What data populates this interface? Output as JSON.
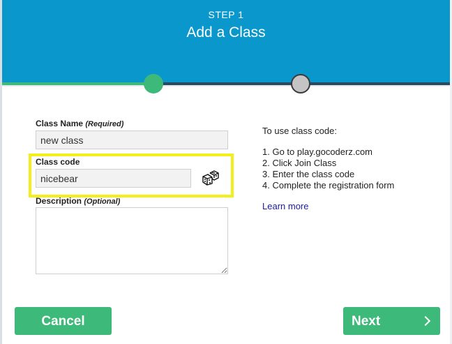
{
  "header": {
    "step": "STEP 1",
    "title": "Add a Class"
  },
  "stepper": {
    "steps": [
      {
        "status": "complete",
        "color": "#3db97a"
      },
      {
        "status": "pending",
        "color": "#c4c4c4"
      }
    ]
  },
  "form": {
    "class_name": {
      "label": "Class Name",
      "hint": "(Required)",
      "value": "new class"
    },
    "class_code": {
      "label": "Class code",
      "value": "nicebear",
      "generate_icon": "dice-icon"
    },
    "description": {
      "label": "Description",
      "hint": "(Optional)",
      "value": ""
    }
  },
  "instructions": {
    "heading": "To use class code:",
    "steps": [
      "1. Go to play.gocoderz.com",
      "2. Click Join Class",
      "3. Enter the class code",
      "4. Complete the registration form"
    ],
    "learn_more": "Learn more"
  },
  "footer": {
    "cancel_label": "Cancel",
    "next_label": "Next",
    "next_icon": "chevron-right-icon"
  },
  "colors": {
    "header_bg": "#0a97cc",
    "accent_green": "#3db97a",
    "highlight": "#f4ee1a",
    "link": "#1a1aa6"
  }
}
